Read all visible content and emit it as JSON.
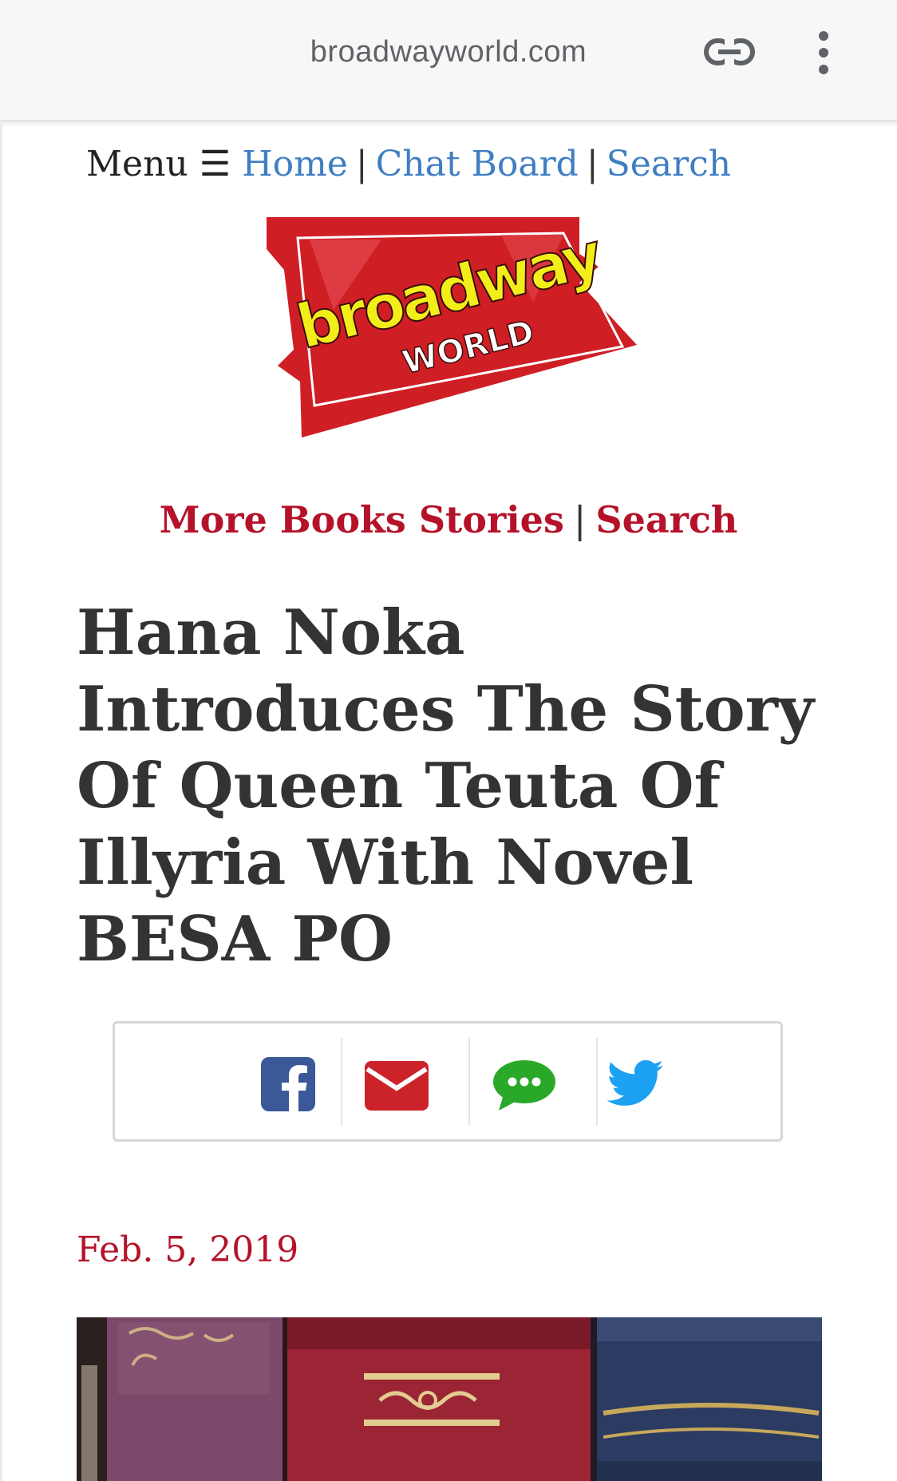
{
  "browser": {
    "url": "broadwayworld.com"
  },
  "topnav": {
    "menu": "Menu ☰",
    "home": "Home",
    "chat_board": "Chat Board",
    "search": "Search",
    "separator": "|"
  },
  "logo": {
    "line1": "broadway",
    "line2": "WORLD"
  },
  "books_nav": {
    "more_stories": "More Books Stories",
    "search": "Search",
    "separator": "|"
  },
  "article": {
    "title": "Hana Noka Introduces The Story Of Queen Teuta Of Illyria With Novel BESA PO",
    "date": "Feb. 5, 2019"
  },
  "share": [
    "facebook-icon",
    "email-icon",
    "message-icon",
    "twitter-icon"
  ],
  "colors": {
    "link_blue": "#3f7ec3",
    "brand_red": "#b5122a",
    "facebook": "#3b5998",
    "email": "#cc2229",
    "message": "#2aa82a",
    "twitter": "#1da1f2"
  }
}
